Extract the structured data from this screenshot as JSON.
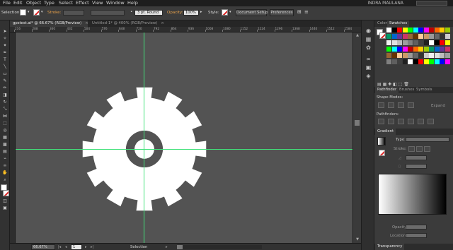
{
  "menu": {
    "items": [
      "File",
      "Edit",
      "Object",
      "Type",
      "Select",
      "Effect",
      "View",
      "Window",
      "Help"
    ],
    "user": "INDRA MAULANA"
  },
  "control": {
    "selection_label": "Selection",
    "stroke_label": "Stroke:",
    "brush_value": "3 pt. Round",
    "opacity_label": "Opacity:",
    "opacity_value": "100%",
    "style_label": "Style:",
    "document_setup": "Document Setup",
    "preferences": "Preferences"
  },
  "tabs": [
    {
      "label": "gpstest.ai* @ 66.67% (RGB/Preview)",
      "active": true
    },
    {
      "label": "Untitled-1* @ 400% (RGB/Preview)",
      "active": false
    }
  ],
  "ruler_ticks": [
    "216",
    "288",
    "360",
    "432",
    "504",
    "576",
    "648",
    "720",
    "792",
    "864",
    "936",
    "1008",
    "1080",
    "1152",
    "1224",
    "1296",
    "1368",
    "1440",
    "1512",
    "1584"
  ],
  "status": {
    "zoom": "66.67%",
    "page": "1",
    "mode": "Selection"
  },
  "panels": {
    "color_tabs": [
      "Color",
      "Swatches"
    ],
    "pathfinder_tabs": [
      "Pathfinder",
      "Brushes",
      "Symbols"
    ],
    "shape_modes": "Shape Modes:",
    "expand": "Expand",
    "pathfinders": "Pathfinders:",
    "gradient_tab": "Gradient",
    "type_label": "Type:",
    "stroke_label": "Stroke:",
    "opacity_label": "Opacity:",
    "location_label": "Location:",
    "transparency_tab": "Transparency"
  },
  "swatch_colors": [
    "#ffffff",
    "#000000",
    "#ff0000",
    "#ffff00",
    "#00ff00",
    "#00ffff",
    "#0000ff",
    "#ff00ff",
    "#c00000",
    "#ff6600",
    "#ffcc00",
    "#99cc00",
    "#009966",
    "#0066cc",
    "#663399",
    "#cc3366",
    "#996633",
    "#663300",
    "#ffcc99",
    "#cc9966",
    "#999999",
    "#666666",
    "#333333",
    "#cccccc",
    "#f0f0f0",
    "#e0e0e0",
    "#bdbdbd",
    "#9e9e9e",
    "#808080",
    "#5f5f5f",
    "#404040",
    "#202020"
  ],
  "colors": {
    "accent_orange": "#e9a24a",
    "guide_green": "#42e27a",
    "canvas_gray": "#535353",
    "gear_white": "#ffffff"
  }
}
